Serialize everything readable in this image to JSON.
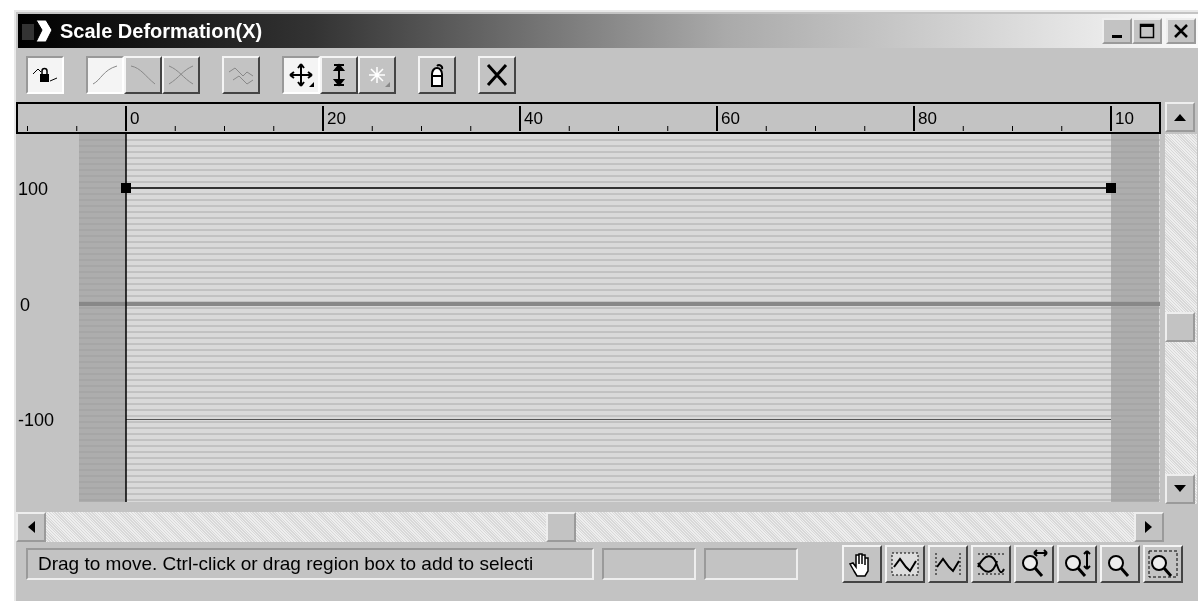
{
  "window": {
    "title": "Scale Deformation(X)"
  },
  "toolbar": {
    "groups": [
      [
        {
          "selected": true,
          "disabled": false
        }
      ],
      [
        {
          "selected": true,
          "disabled": true
        },
        {
          "selected": false,
          "disabled": true
        },
        {
          "selected": false,
          "disabled": true
        }
      ],
      [
        {
          "selected": false,
          "disabled": true
        }
      ],
      [
        {
          "selected": true,
          "disabled": false
        },
        {
          "selected": false,
          "disabled": false
        },
        {
          "selected": false,
          "disabled": true
        }
      ],
      [
        {
          "selected": false,
          "disabled": false
        }
      ],
      [
        {
          "selected": false,
          "disabled": false
        }
      ]
    ]
  },
  "ruler": {
    "labels": [
      "0",
      "20",
      "40",
      "60",
      "80",
      "10"
    ]
  },
  "graph": {
    "y_labels": [
      "100",
      "0",
      "-100"
    ]
  },
  "status_bar": {
    "message": "Drag to move. Ctrl-click or drag region box to add to selecti"
  }
}
